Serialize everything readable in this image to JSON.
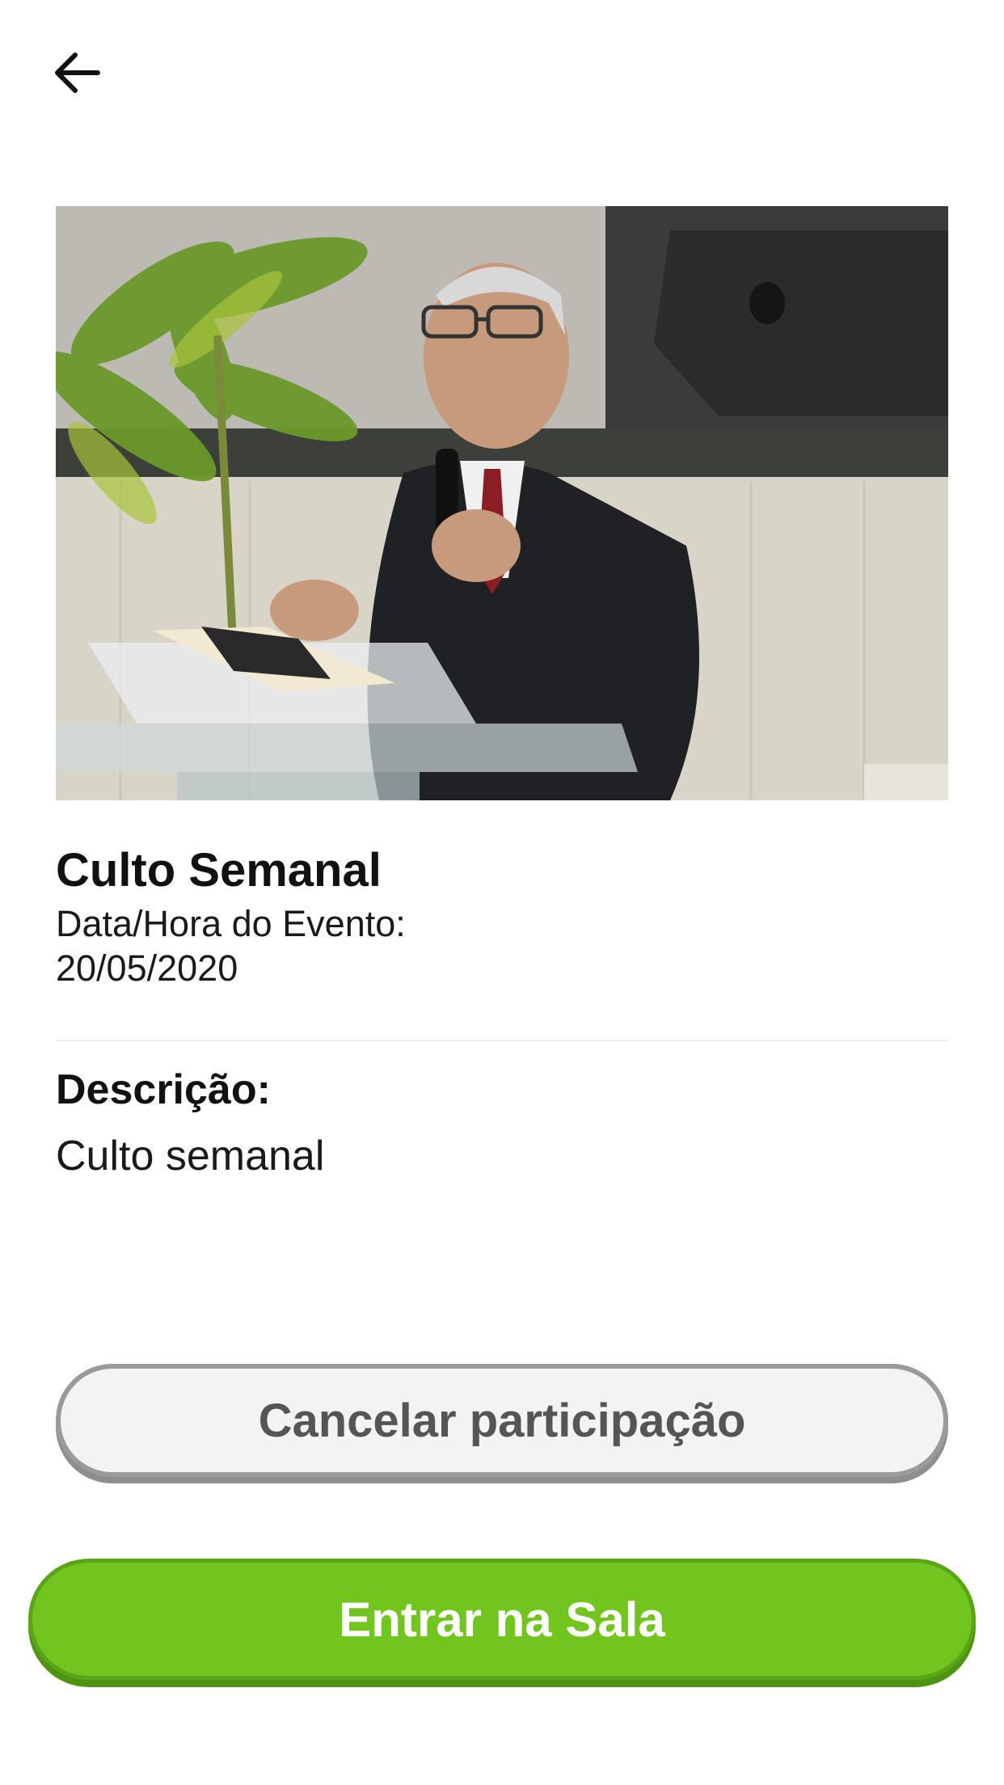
{
  "header": {
    "back_icon": "arrow-left-icon"
  },
  "event": {
    "image_alt": "Pastor pregando no púlpito",
    "title": "Culto Semanal",
    "date_label": "Data/Hora do Evento:",
    "date_value": "20/05/2020"
  },
  "description": {
    "label": "Descrição:",
    "value": "Culto semanal"
  },
  "actions": {
    "cancel_label": "Cancelar participação",
    "enter_label": "Entrar na Sala"
  },
  "colors": {
    "primary_green": "#72c51f",
    "cancel_bg": "#f3f3f3",
    "cancel_border": "#9a9a9a",
    "cancel_text": "#555555"
  }
}
